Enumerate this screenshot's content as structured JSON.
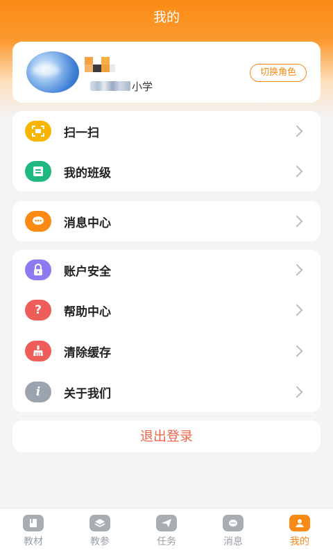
{
  "page": {
    "title": "我的"
  },
  "profile": {
    "school_suffix": "小学",
    "switch_role_label": "切换角色"
  },
  "groups": [
    {
      "items": [
        {
          "label": "扫一扫",
          "icon": "scan-icon",
          "color": "#f7b500"
        },
        {
          "label": "我的班级",
          "icon": "class-icon",
          "color": "#1fb97f"
        }
      ]
    },
    {
      "items": [
        {
          "label": "消息中心",
          "icon": "message-icon",
          "color": "#fb8a15"
        }
      ]
    },
    {
      "items": [
        {
          "label": "账户安全",
          "icon": "lock-icon",
          "color": "#8c7bf0"
        },
        {
          "label": "帮助中心",
          "icon": "help-icon",
          "color": "#ef5d5a"
        },
        {
          "label": "清除缓存",
          "icon": "broom-icon",
          "color": "#ef5d5a"
        },
        {
          "label": "关于我们",
          "icon": "info-icon",
          "color": "#9aa3ae"
        }
      ]
    }
  ],
  "logout_label": "退出登录",
  "tabbar": [
    {
      "label": "教材",
      "icon": "book-icon",
      "active": false
    },
    {
      "label": "教参",
      "icon": "layers-icon",
      "active": false
    },
    {
      "label": "任务",
      "icon": "send-icon",
      "active": false
    },
    {
      "label": "消息",
      "icon": "chat-icon",
      "active": false
    },
    {
      "label": "我的",
      "icon": "user-icon",
      "active": true
    }
  ],
  "colors": {
    "accent": "#fb8a15",
    "logout": "#f0674d"
  }
}
